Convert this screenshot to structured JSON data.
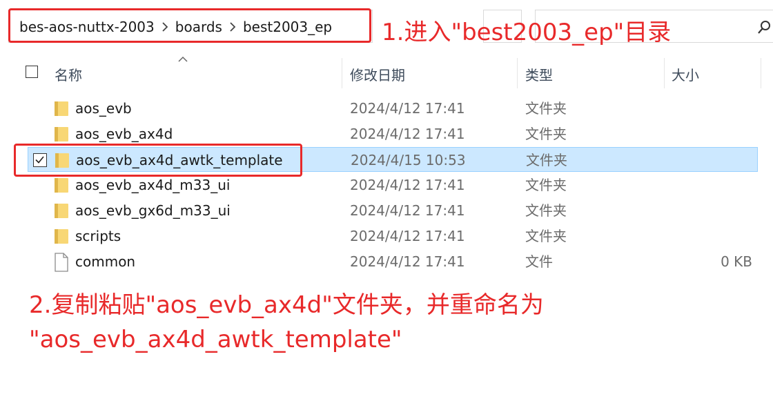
{
  "address_bar": {
    "crumbs": [
      "bes-aos-nuttx-2003",
      "boards",
      "best2003_ep"
    ]
  },
  "columns": {
    "name": "名称",
    "date": "修改日期",
    "type": "类型",
    "size": "大小"
  },
  "rows": [
    {
      "name": "aos_evb",
      "date": "2024/4/12 17:41",
      "type": "文件夹",
      "size": "",
      "icon": "folder-icon"
    },
    {
      "name": "aos_evb_ax4d",
      "date": "2024/4/12 17:41",
      "type": "文件夹",
      "size": "",
      "icon": "folder-icon"
    },
    {
      "name": "aos_evb_ax4d_awtk_template",
      "date": "2024/4/15 10:53",
      "type": "文件夹",
      "size": "",
      "icon": "folder-icon",
      "selected": true
    },
    {
      "name": "aos_evb_ax4d_m33_ui",
      "date": "2024/4/12 17:41",
      "type": "文件夹",
      "size": "",
      "icon": "folder-icon"
    },
    {
      "name": "aos_evb_gx6d_m33_ui",
      "date": "2024/4/12 17:41",
      "type": "文件夹",
      "size": "",
      "icon": "folder-icon"
    },
    {
      "name": "scripts",
      "date": "2024/4/12 17:41",
      "type": "文件夹",
      "size": "",
      "icon": "folder-icon"
    },
    {
      "name": "common",
      "date": "2024/4/12 17:41",
      "type": "文件",
      "size": "0 KB",
      "icon": "file-icon"
    }
  ],
  "annotations": {
    "step1": "1.进入\"best2003_ep\"目录",
    "step2_line1": "2.复制粘贴\"aos_evb_ax4d\"文件夹，并重命名为",
    "step2_line2": "\"aos_evb_ax4d_awtk_template\""
  },
  "colors": {
    "annotation_red": "#e8292a",
    "selection_bg": "#cce8ff",
    "folder_yellow": "#f8d775"
  }
}
